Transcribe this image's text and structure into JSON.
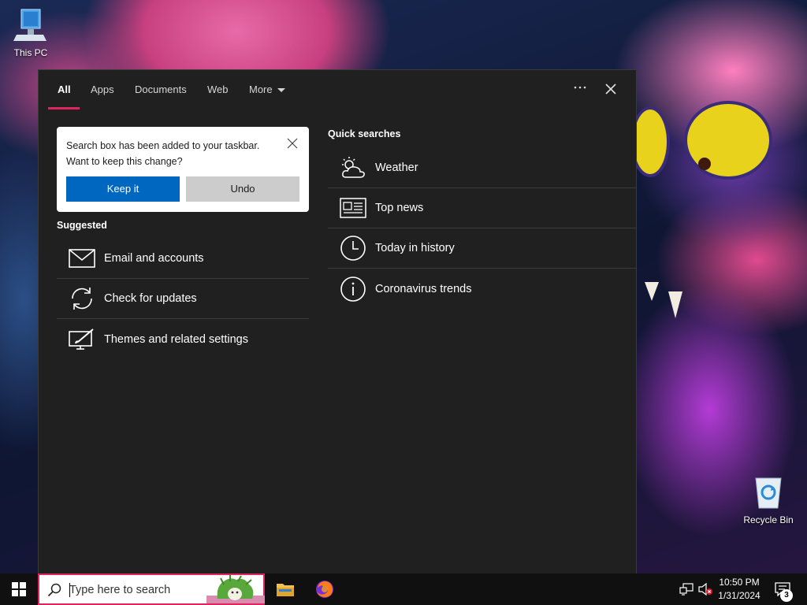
{
  "desktop": {
    "icons": [
      {
        "label": "This PC"
      },
      {
        "label": "Recycle Bin"
      }
    ]
  },
  "search_panel": {
    "tabs": [
      {
        "label": "All",
        "active": true
      },
      {
        "label": "Apps"
      },
      {
        "label": "Documents"
      },
      {
        "label": "Web"
      },
      {
        "label": "More"
      }
    ],
    "toast": {
      "message": "Search box has been added to your taskbar. Want to keep this change?",
      "keep_label": "Keep it",
      "undo_label": "Undo"
    },
    "suggested": {
      "title": "Suggested",
      "items": [
        {
          "label": "Email and accounts",
          "icon": "mail-icon"
        },
        {
          "label": "Check for updates",
          "icon": "sync-icon"
        },
        {
          "label": "Themes and related settings",
          "icon": "themes-icon"
        }
      ]
    },
    "quick_searches": {
      "title": "Quick searches",
      "items": [
        {
          "label": "Weather",
          "icon": "weather-icon"
        },
        {
          "label": "Top news",
          "icon": "news-icon"
        },
        {
          "label": "Today in history",
          "icon": "clock-icon"
        },
        {
          "label": "Coronavirus trends",
          "icon": "info-icon"
        }
      ]
    }
  },
  "taskbar": {
    "search_placeholder": "Type here to search",
    "clock": {
      "time": "10:50 PM",
      "date": "1/31/2024"
    },
    "notification_count": "3"
  },
  "colors": {
    "accent_red": "#e0245e",
    "primary_blue": "#0067c0",
    "panel_bg": "#202020"
  }
}
